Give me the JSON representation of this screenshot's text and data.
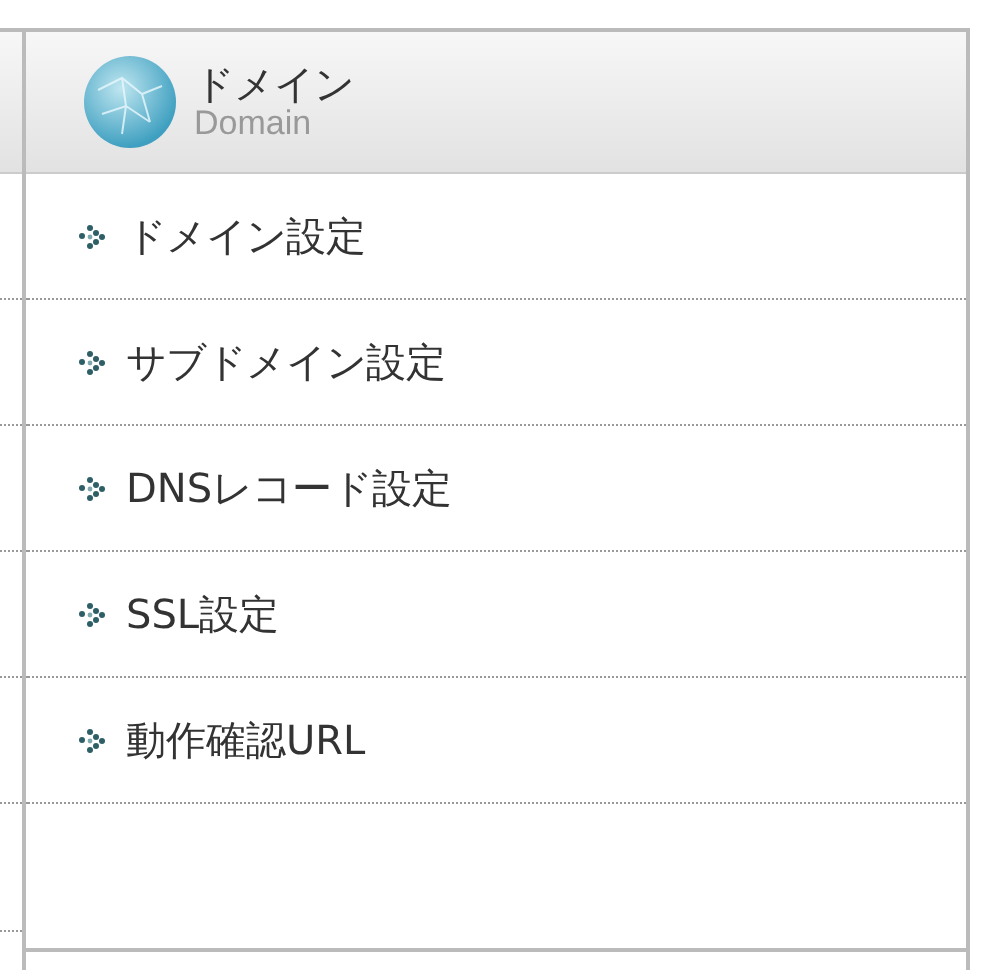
{
  "header": {
    "title": "ドメイン",
    "subtitle": "Domain"
  },
  "items": [
    {
      "label": "ドメイン設定"
    },
    {
      "label": "サブドメイン設定"
    },
    {
      "label": "DNSレコード設定"
    },
    {
      "label": "SSL設定"
    },
    {
      "label": "動作確認URL"
    }
  ]
}
